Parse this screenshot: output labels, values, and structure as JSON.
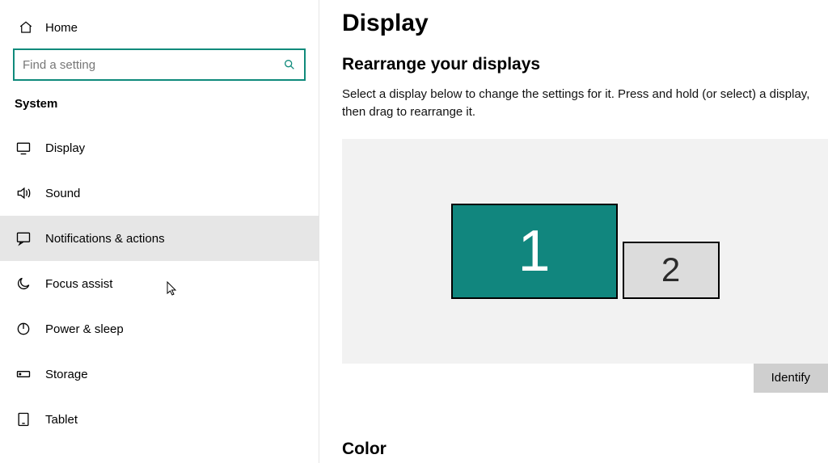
{
  "sidebar": {
    "home_label": "Home",
    "search_placeholder": "Find a setting",
    "section_title": "System",
    "items": [
      {
        "label": "Display"
      },
      {
        "label": "Sound"
      },
      {
        "label": "Notifications & actions"
      },
      {
        "label": "Focus assist"
      },
      {
        "label": "Power & sleep"
      },
      {
        "label": "Storage"
      },
      {
        "label": "Tablet"
      }
    ]
  },
  "main": {
    "title": "Display",
    "rearrange_heading": "Rearrange your displays",
    "rearrange_desc": "Select a display below to change the settings for it. Press and hold (or select) a display, then drag to rearrange it.",
    "monitor1": "1",
    "monitor2": "2",
    "identify_label": "Identify",
    "color_heading": "Color"
  }
}
